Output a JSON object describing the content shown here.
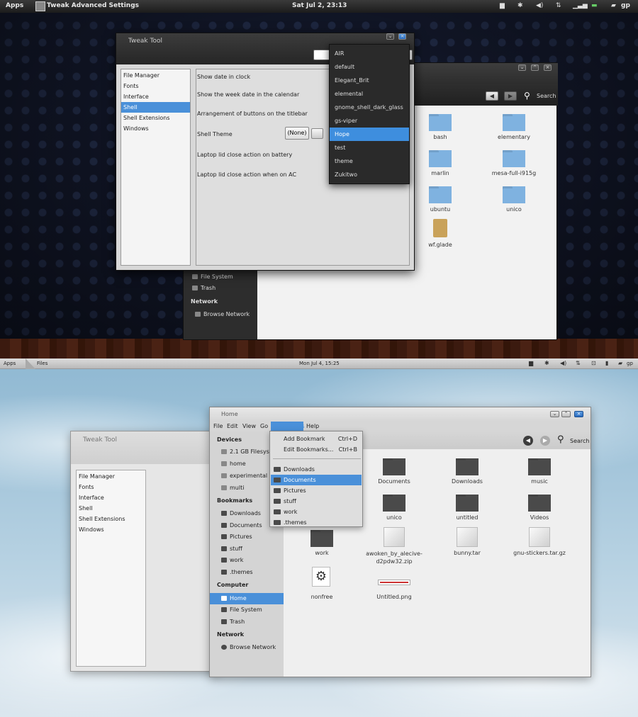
{
  "top": {
    "panel": {
      "apps": "Apps",
      "active_app": "Tweak Advanced Settings",
      "clock": "Sat Jul 2, 23:13",
      "user": "gp"
    },
    "files_window": {
      "search_label": "Search",
      "folders": [
        "bash",
        "elementary",
        "marlin",
        "mesa-full-i915g",
        "ubuntu",
        "unico"
      ],
      "file": "wf.glade",
      "sidebar": {
        "file_system": "File System",
        "trash": "Trash",
        "network_header": "Network",
        "browse_network": "Browse Network"
      }
    },
    "tweak_tool": {
      "title": "Tweak Tool",
      "categories": [
        "File Manager",
        "Fonts",
        "Interface",
        "Shell",
        "Shell Extensions",
        "Windows"
      ],
      "selected_category": "Shell",
      "settings": [
        "Show date in clock",
        "Show the week date in the calendar",
        "Arrangement of buttons on the titlebar",
        "Shell Theme",
        "Laptop lid close action on battery",
        "Laptop lid close action when on AC"
      ],
      "shell_theme_value": "(None)"
    },
    "theme_dropdown": {
      "options": [
        "AIR",
        "default",
        "Elegant_Brit",
        "elemental",
        "gnome_shell_dark_glass",
        "gs-viper",
        "Hope",
        "test",
        "theme",
        "Zukitwo"
      ],
      "selected": "Hope"
    }
  },
  "bottom": {
    "panel": {
      "apps": "Apps",
      "active_app": "Files",
      "clock": "Mon Jul 4, 15:25",
      "user": "gp"
    },
    "tweak_tool": {
      "title": "Tweak Tool",
      "categories": [
        "File Manager",
        "Fonts",
        "Interface",
        "Shell",
        "Shell Extensions",
        "Windows"
      ]
    },
    "files_window": {
      "title": "Home",
      "menu": [
        "File",
        "Edit",
        "View",
        "Go",
        "Bookmarks",
        "Help"
      ],
      "search_label": "Search",
      "sidebar": {
        "devices_header": "Devices",
        "devices": [
          "2.1 GB Filesyste",
          "home",
          "experimental",
          "multi"
        ],
        "bookmarks_header": "Bookmarks",
        "bookmarks": [
          "Downloads",
          "Documents",
          "Pictures",
          "stuff",
          "work",
          ".themes"
        ],
        "computer_header": "Computer",
        "computer": [
          "Home",
          "File System",
          "Trash"
        ],
        "selected": "Home",
        "network_header": "Network",
        "network": [
          "Browse Network"
        ]
      },
      "items": [
        {
          "name": "Documents",
          "kind": "folder"
        },
        {
          "name": "Downloads",
          "kind": "folder"
        },
        {
          "name": "music",
          "kind": "folder"
        },
        {
          "name": "unico",
          "kind": "folder"
        },
        {
          "name": "untitled",
          "kind": "folder"
        },
        {
          "name": "Videos",
          "kind": "folder"
        },
        {
          "name": "work",
          "kind": "folder"
        },
        {
          "name": "awoken_by_alecive-\nd2pdw32.zip",
          "kind": "archive"
        },
        {
          "name": "bunny.tar",
          "kind": "archive"
        },
        {
          "name": "gnu-stickers.tar.gz",
          "kind": "archive"
        },
        {
          "name": "nonfree",
          "kind": "executable"
        },
        {
          "name": "Untitled.png",
          "kind": "image"
        }
      ]
    },
    "bookmarks_menu": {
      "add": "Add Bookmark",
      "add_accel": "Ctrl+D",
      "edit": "Edit Bookmarks...",
      "edit_accel": "Ctrl+B",
      "places": [
        "Downloads",
        "Documents",
        "Pictures",
        "stuff",
        "work",
        ".themes"
      ],
      "selected": "Documents"
    }
  },
  "colors": {
    "selection_blue": "#4a90d9",
    "dark_panel": "#1c1c1c",
    "light_panel": "#c9c9c9"
  }
}
